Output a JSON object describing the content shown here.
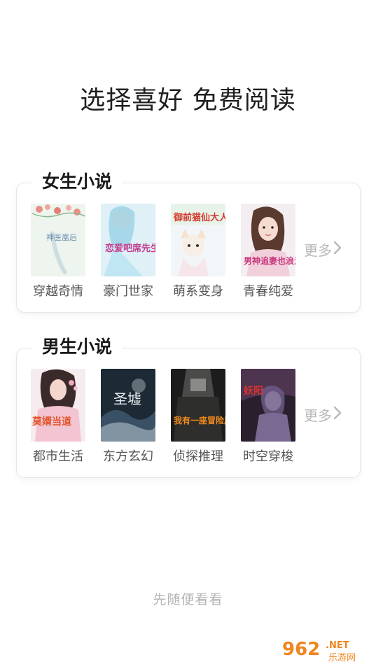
{
  "headline": "选择喜好 免费阅读",
  "female": {
    "title": "女生小说",
    "more": "更多",
    "books": [
      {
        "label": "穿越奇情",
        "cover_text": "神医凰后"
      },
      {
        "label": "豪门世家",
        "cover_text": "恋爱吧席先生"
      },
      {
        "label": "萌系变身",
        "cover_text": "御前猫仙大人"
      },
      {
        "label": "青春纯爱",
        "cover_text": "男神追妻也浪漫"
      }
    ]
  },
  "male": {
    "title": "男生小说",
    "more": "更多",
    "books": [
      {
        "label": "都市生活",
        "cover_text": "莫婿当道"
      },
      {
        "label": "东方玄幻",
        "cover_text": "圣墟"
      },
      {
        "label": "侦探推理",
        "cover_text": "我有一座冒险屋"
      },
      {
        "label": "时空穿梭",
        "cover_text": "妖阳"
      }
    ]
  },
  "skip_label": "先随便看看",
  "watermark": {
    "number": "962",
    "tld": ".NET",
    "site": "乐游网"
  },
  "colors": {
    "accent_orange": "#f0861f",
    "more_gray": "#b8b8b8",
    "skip_gray": "#b5b5b5"
  }
}
